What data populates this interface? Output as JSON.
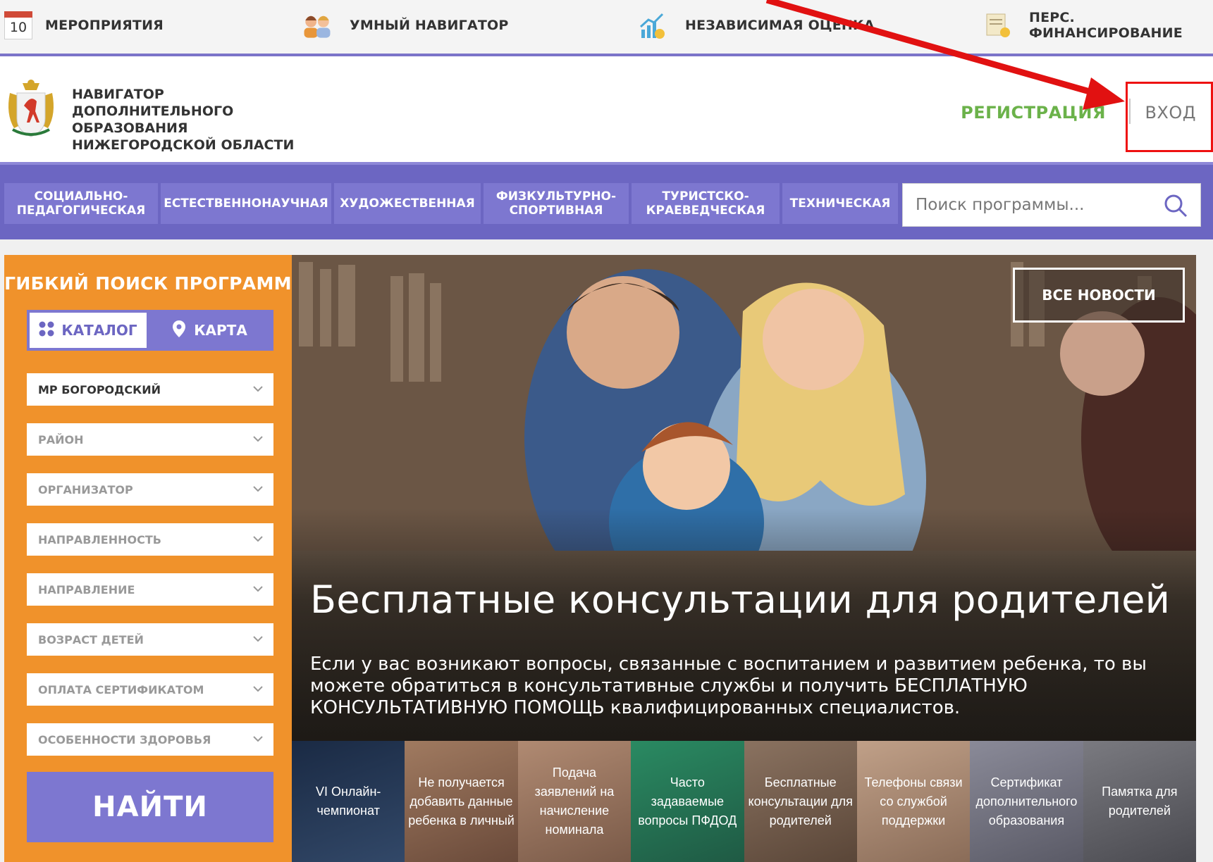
{
  "topbar": {
    "calendar_day": "10",
    "items": [
      {
        "label": "МЕРОПРИЯТИЯ",
        "icon": "calendar-icon"
      },
      {
        "label": "УМНЫЙ НАВИГАТОР",
        "icon": "people-icon"
      },
      {
        "label": "НЕЗАВИСИМАЯ ОЦЕНКА",
        "icon": "chart-growth-icon"
      },
      {
        "label": "ПЕРС. ФИНАНСИРОВАНИЕ",
        "icon": "certificate-icon"
      }
    ]
  },
  "header": {
    "site_title": "НАВИГАТОР ДОПОЛНИТЕЛЬНОГО ОБРАЗОВАНИЯ НИЖЕГОРОДСКОЙ ОБЛАСТИ",
    "register": "РЕГИСТРАЦИЯ",
    "login": "ВХОД"
  },
  "categories": [
    "СОЦИАЛЬНО-ПЕДАГОГИЧЕСКАЯ",
    "ЕСТЕСТВЕННОНАУЧНАЯ",
    "ХУДОЖЕСТВЕННАЯ",
    "ФИЗКУЛЬТУРНО-СПОРТИВНАЯ",
    "ТУРИСТСКО-КРАЕВЕДЧЕСКАЯ",
    "ТЕХНИЧЕСКАЯ"
  ],
  "search": {
    "placeholder": "Поиск программы..."
  },
  "filter": {
    "title": "ГИБКИЙ ПОИСК ПРОГРАММ",
    "tab_catalog": "КАТАЛОГ",
    "tab_map": "КАРТА",
    "selects": [
      "МР БОГОРОДСКИЙ",
      "РАЙОН",
      "ОРГАНИЗАТОР",
      "НАПРАВЛЕННОСТЬ",
      "НАПРАВЛЕНИЕ",
      "ВОЗРАСТ ДЕТЕЙ",
      "ОПЛАТА СЕРТИФИКАТОМ",
      "ОСОБЕННОСТИ ЗДОРОВЬЯ"
    ],
    "find_button": "НАЙТИ"
  },
  "hero": {
    "all_news": "ВСЕ НОВОСТИ",
    "title": "Бесплатные консультации для родителей",
    "text": "Если у вас возникают вопросы, связанные с воспитанием и развитием ребенка, то вы можете обратиться в консультативные службы и получить БЕСПЛАТНУЮ КОНСУЛЬТАТИВНУЮ ПОМОЩЬ квалифицированных специалистов."
  },
  "news_thumbs": [
    {
      "text": "VI Онлайн-чемпионат",
      "color": "#23324a"
    },
    {
      "text": "Не получается добавить данные ребенка в личный",
      "color": "#8a6a55"
    },
    {
      "text": "Подача заявлений на начисление номинала",
      "color": "#9a7a66"
    },
    {
      "text": "Часто задаваемые вопросы ПФДОД",
      "color": "#2f7a5a"
    },
    {
      "text": "Бесплатные консультации для родителей",
      "color": "#7a6452"
    },
    {
      "text": "Телефоны связи со службой поддержки",
      "color": "#a88a72"
    },
    {
      "text": "Сертификат дополнительного образования",
      "color": "#7a7a86"
    },
    {
      "text": "Памятка для родителей",
      "color": "#6a6a70"
    }
  ],
  "colors": {
    "accent_purple": "#6c66c2",
    "orange": "#f0922b",
    "register_green": "#6bb24a",
    "annotation_red": "#e11111"
  }
}
